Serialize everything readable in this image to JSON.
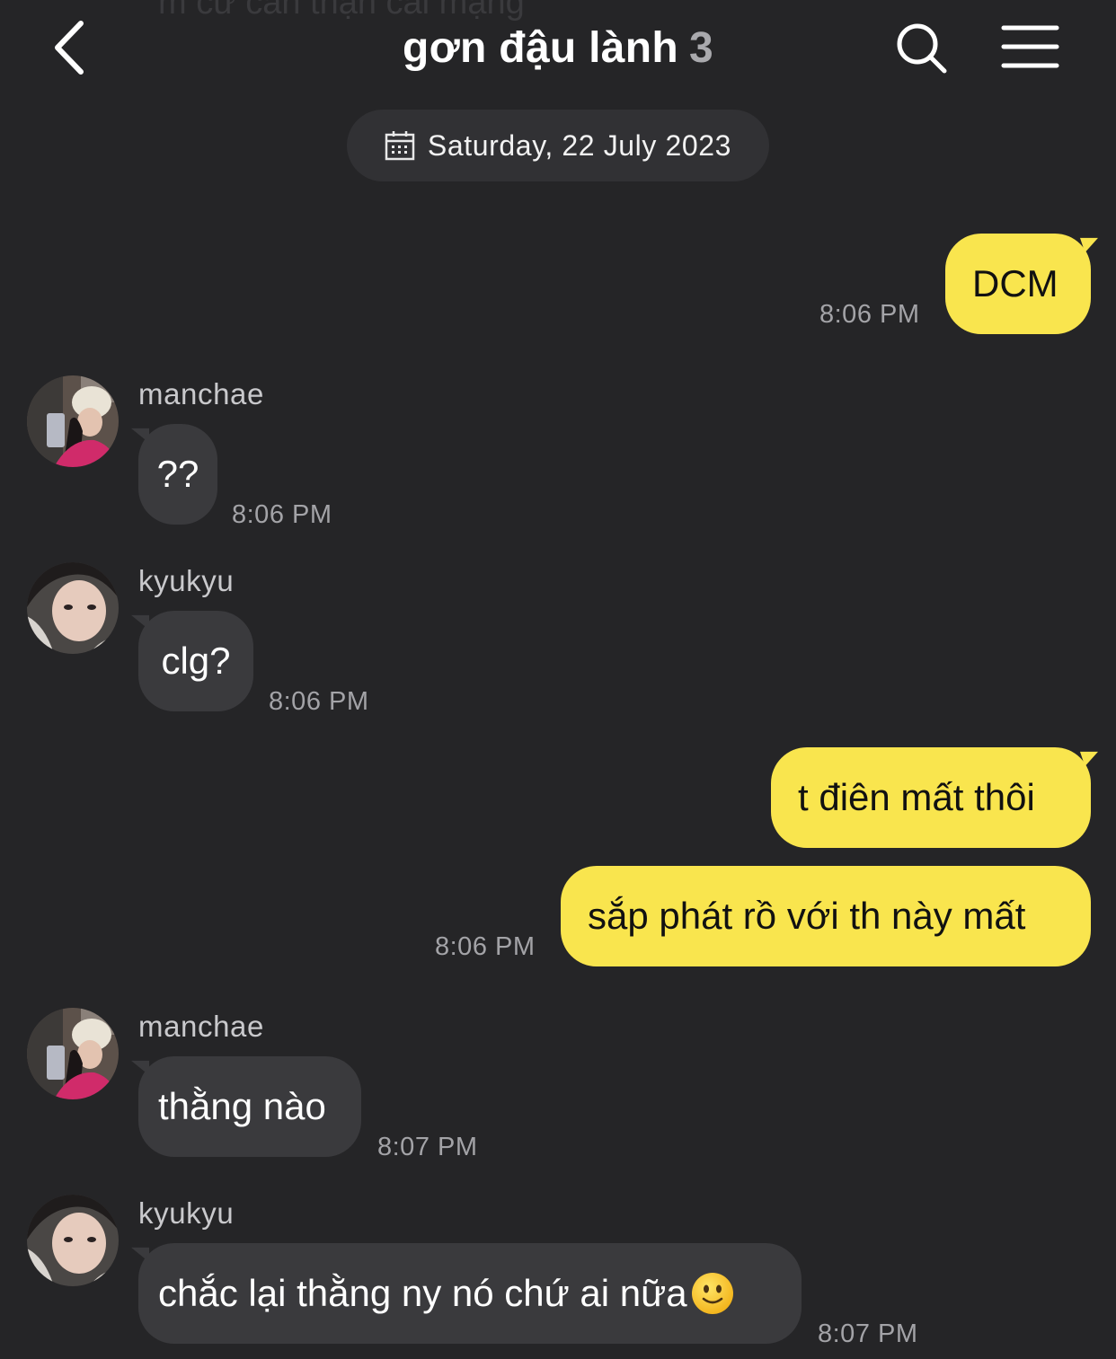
{
  "header": {
    "title": "gơn đậu lành",
    "member_count": "3",
    "behind_text": "m cứ cẩn thận cái mạng"
  },
  "date_divider": "Saturday, 22 July 2023",
  "messages": [
    {
      "sender": "",
      "text": "DCM",
      "time": "8:06 PM"
    },
    {
      "sender": "manchae",
      "text": "??",
      "time": "8:06 PM"
    },
    {
      "sender": "kyukyu",
      "text": "clg?",
      "time": "8:06 PM"
    },
    {
      "sender": "",
      "text": "t điên mất thôi",
      "time": ""
    },
    {
      "sender": "",
      "text": "sắp phát rồ với th này mất",
      "time": "8:06 PM"
    },
    {
      "sender": "manchae",
      "text": "thằng nào",
      "time": "8:07 PM"
    },
    {
      "sender": "kyukyu",
      "text": "chắc lại thằng ny nó chứ ai nữa",
      "emoji": "slightly-smiling-face",
      "time": "8:07 PM"
    }
  ],
  "colors": {
    "background": "#252527",
    "outgoing_bubble": "#f9e54e",
    "incoming_bubble": "#3a3a3d",
    "timestamp": "#a3a3a7"
  }
}
